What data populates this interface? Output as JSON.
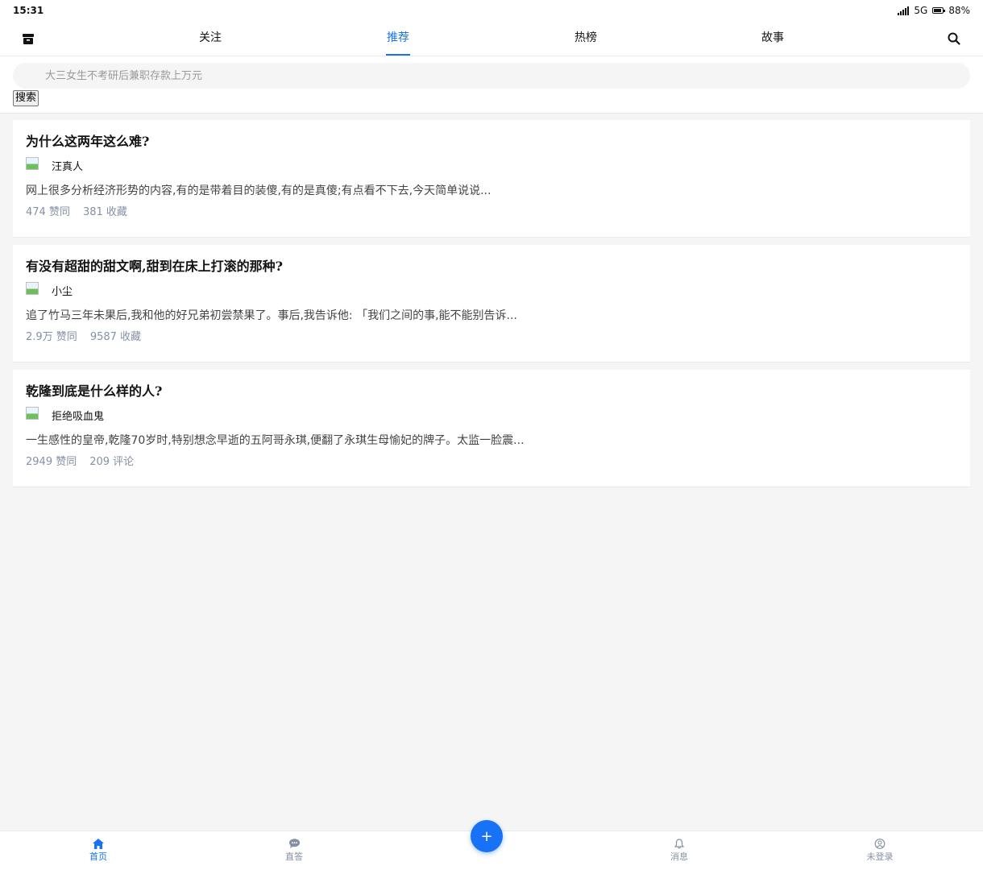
{
  "status_bar": {
    "time": "15:31",
    "network": "5G",
    "battery": "88%",
    "battery_level": 0.88
  },
  "top_nav": {
    "left_icon": "archive-icon",
    "tabs": [
      {
        "label": "关注",
        "active": false
      },
      {
        "label": "推荐",
        "active": true
      },
      {
        "label": "热榜",
        "active": false
      },
      {
        "label": "故事",
        "active": false
      }
    ],
    "right_icon": "search-icon",
    "accent_color": "#1772f6"
  },
  "search": {
    "placeholder": "大三女生不考研后兼职存款上万元",
    "button_label": "搜索"
  },
  "feed": [
    {
      "title": "为什么这两年这么难?",
      "author": "汪真人",
      "excerpt": "网上很多分析经济形势的内容,有的是带着目的装傻,有的是真傻;有点看不下去,今天简单说说...",
      "stats": [
        "474 赞同",
        "381 收藏"
      ]
    },
    {
      "title": "有没有超甜的甜文啊,甜到在床上打滚的那种?",
      "author": "小尘",
      "excerpt": "追了竹马三年未果后,我和他的好兄弟初尝禁果了。事后,我告诉他: 「我们之间的事,能不能别告诉...",
      "stats": [
        "2.9万 赞同",
        "9587 收藏"
      ]
    },
    {
      "title": "乾隆到底是什么样的人?",
      "author": "拒绝吸血鬼",
      "excerpt": "一生感性的皇帝,乾隆70岁时,特别想念早逝的五阿哥永琪,便翻了永琪生母愉妃的牌子。太监一脸震...",
      "stats": [
        "2949 赞同",
        "209 评论"
      ]
    }
  ],
  "bottom_bar": {
    "tabs": [
      {
        "label": "首页",
        "icon": "home-icon",
        "active": true
      },
      {
        "label": "直答",
        "icon": "chat-bubble-icon",
        "active": false
      },
      {
        "label": "消息",
        "icon": "bell-icon",
        "active": false
      },
      {
        "label": "未登录",
        "icon": "user-icon",
        "active": false
      }
    ],
    "fab_icon": "plus-icon",
    "fab_label": "+"
  }
}
